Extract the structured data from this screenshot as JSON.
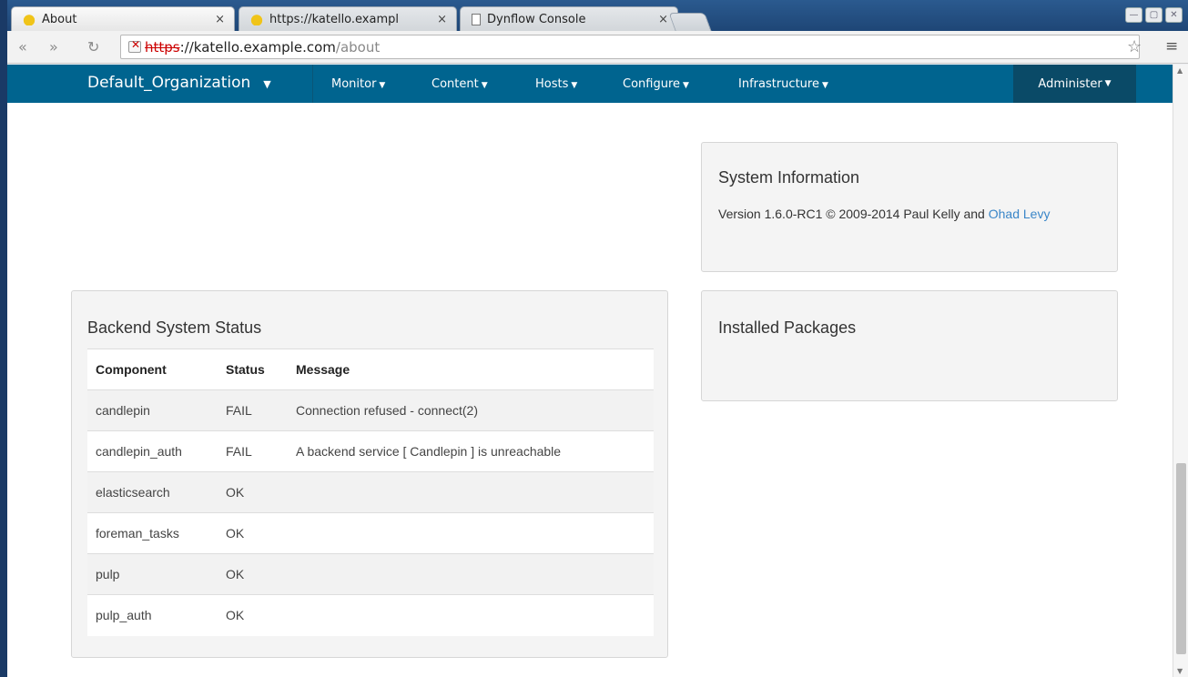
{
  "browser": {
    "tabs": [
      {
        "title": "About",
        "icon": "yellow-hat-icon",
        "active": true
      },
      {
        "title": "https://katello.exampl",
        "icon": "yellow-hat-icon",
        "active": false
      },
      {
        "title": "Dynflow Console",
        "icon": "document-icon",
        "active": false
      }
    ],
    "tab_close": "×",
    "url": {
      "scheme": "https",
      "host": "://katello.example.com",
      "path": "/about"
    }
  },
  "appnav": {
    "org": "Default_Organization",
    "menus": [
      "Monitor",
      "Content",
      "Hosts",
      "Configure",
      "Infrastructure"
    ],
    "administer": "Administer",
    "color": "#00648f"
  },
  "system_info": {
    "title": "System Information",
    "version_text": "Version 1.6.0-RC1 © 2009-2014 Paul Kelly and ",
    "link_text": "Ohad Levy"
  },
  "installed_packages": {
    "title": "Installed Packages"
  },
  "backend_status": {
    "title": "Backend System Status",
    "columns": [
      "Component",
      "Status",
      "Message"
    ],
    "rows": [
      {
        "component": "candlepin",
        "status": "FAIL",
        "message": "Connection refused - connect(2)"
      },
      {
        "component": "candlepin_auth",
        "status": "FAIL",
        "message": "A backend service [ Candlepin ] is unreachable"
      },
      {
        "component": "elasticsearch",
        "status": "OK",
        "message": ""
      },
      {
        "component": "foreman_tasks",
        "status": "OK",
        "message": ""
      },
      {
        "component": "pulp",
        "status": "OK",
        "message": ""
      },
      {
        "component": "pulp_auth",
        "status": "OK",
        "message": ""
      }
    ]
  }
}
